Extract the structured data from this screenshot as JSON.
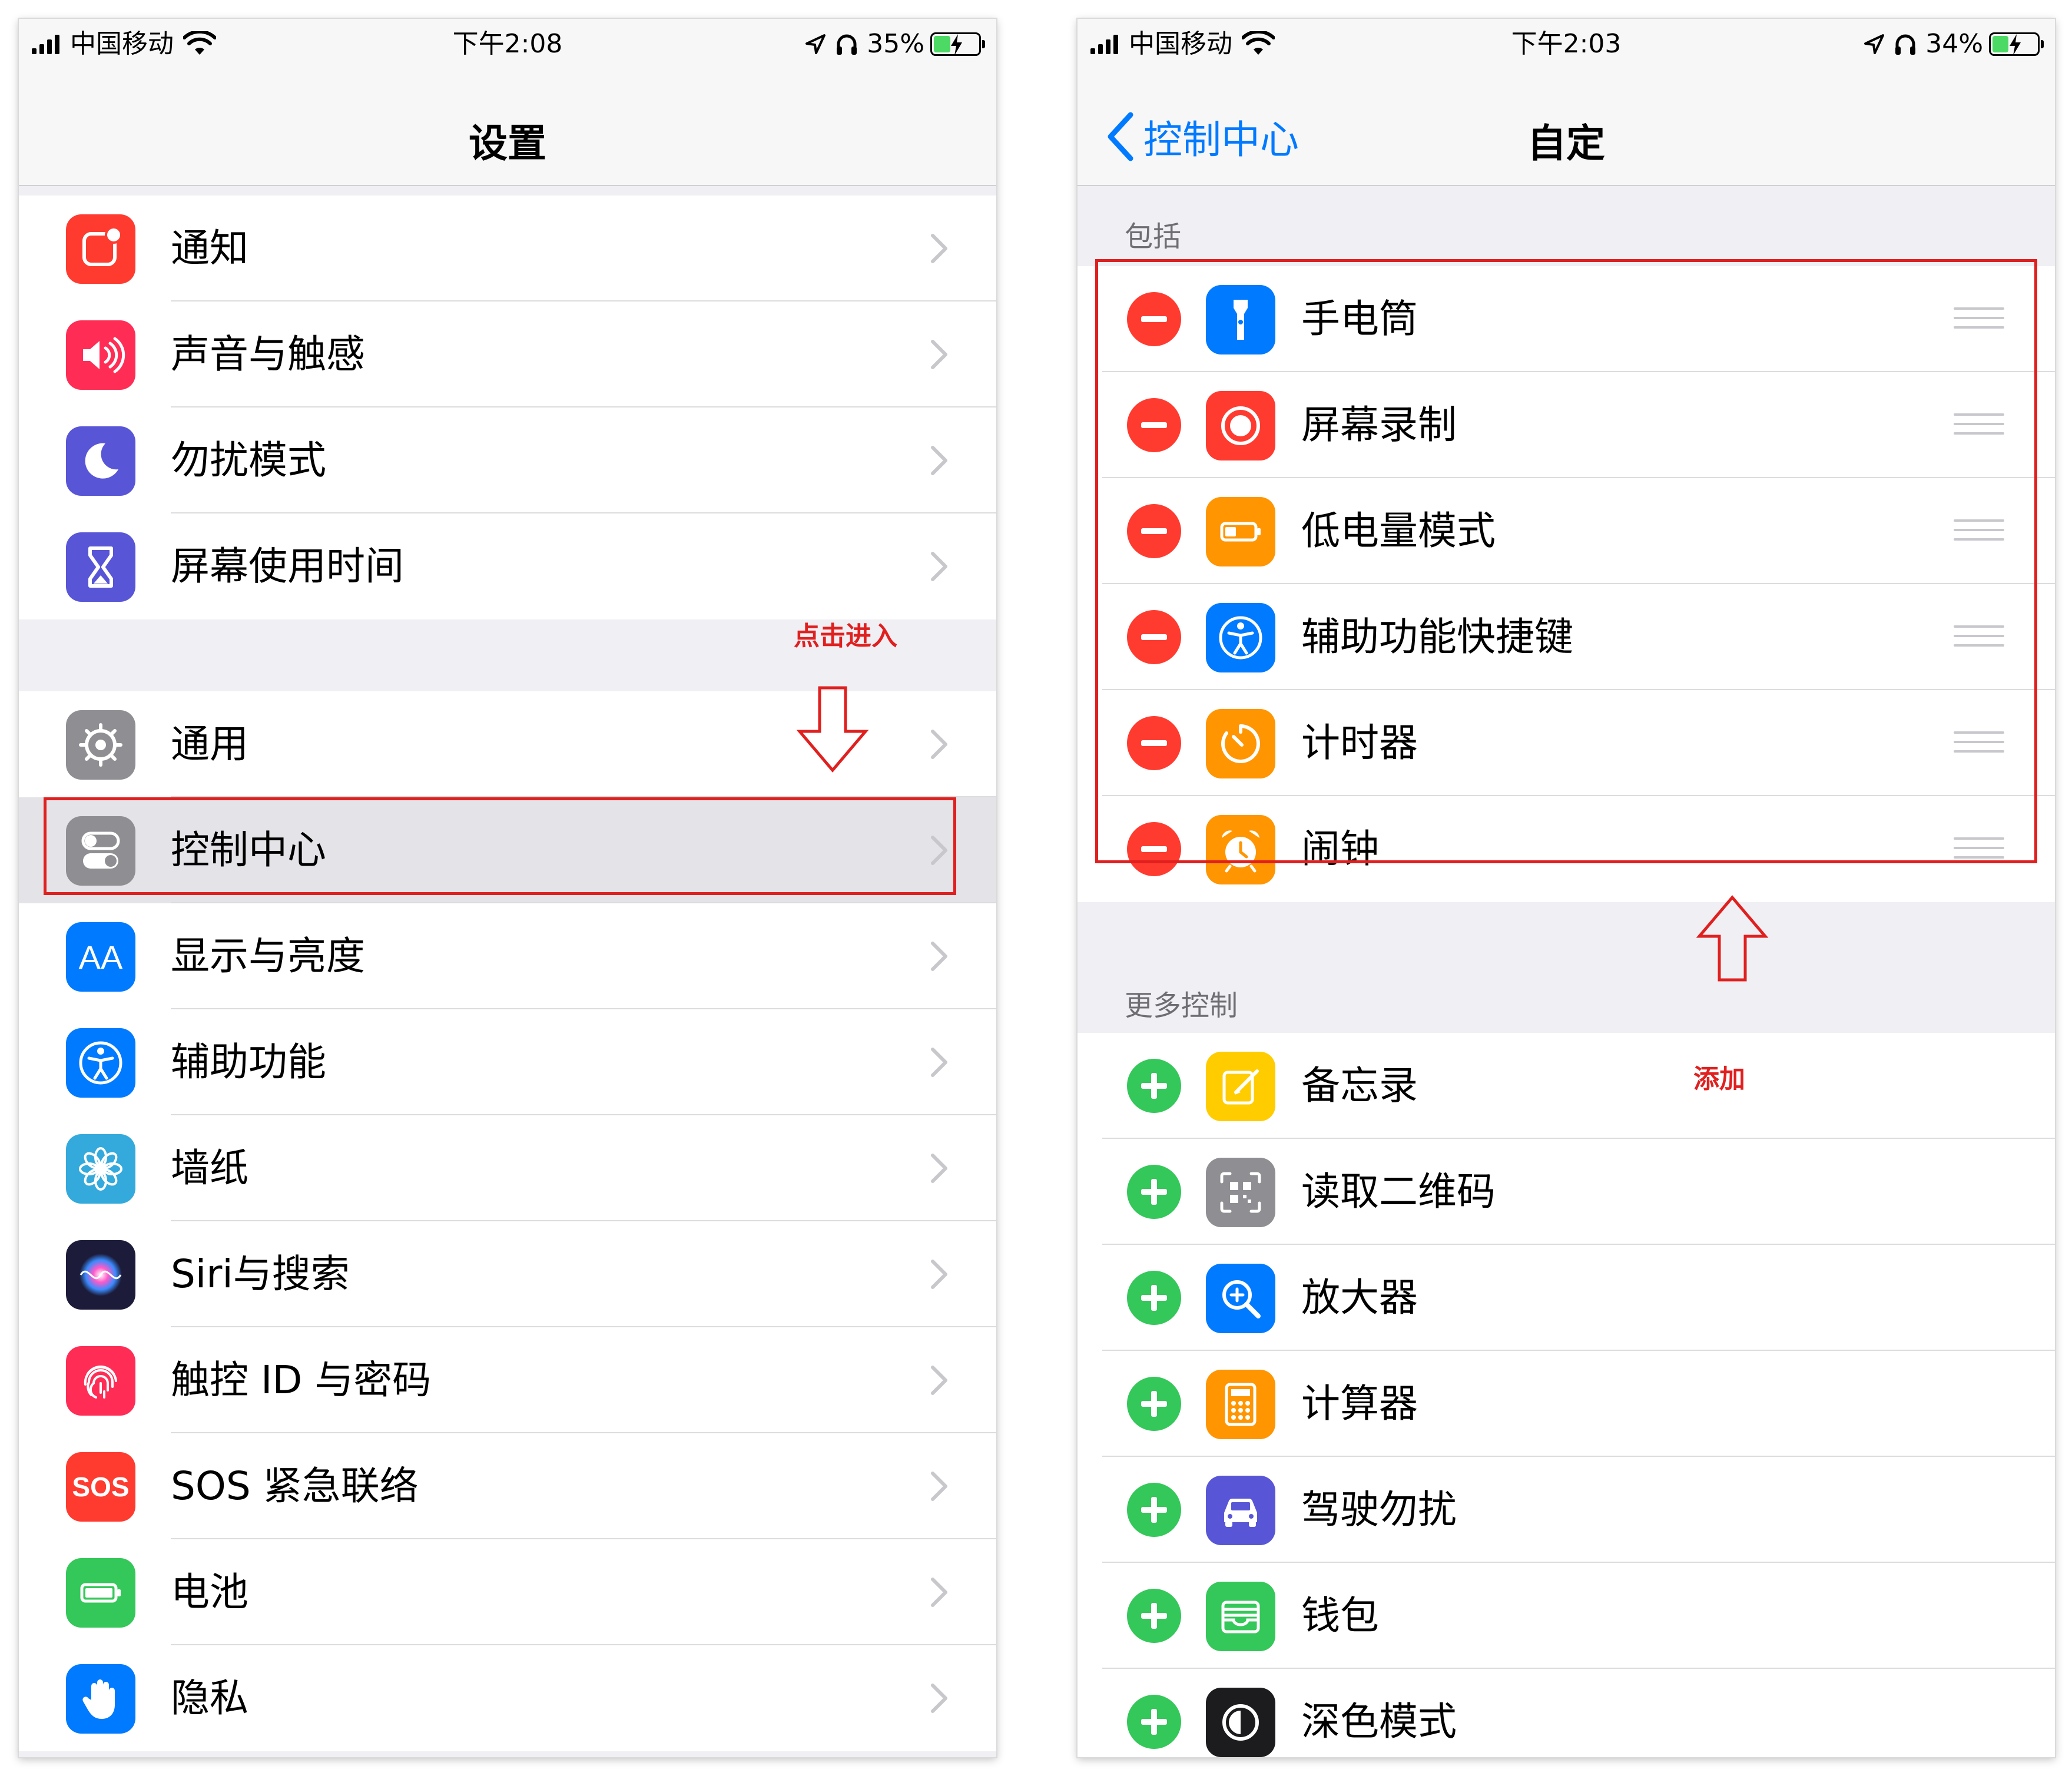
{
  "left_screen": {
    "status": {
      "carrier": "中国移动",
      "time": "下午2:08",
      "battery": "35%",
      "battery_level": 0.35
    },
    "title": "设置",
    "group1": [
      {
        "label": "通知",
        "icon": "notifications-icon",
        "color": "#ff3b30"
      },
      {
        "label": "声音与触感",
        "icon": "speaker-icon",
        "color": "#ff2d55"
      },
      {
        "label": "勿扰模式",
        "icon": "moon-icon",
        "color": "#5856d6"
      },
      {
        "label": "屏幕使用时间",
        "icon": "hourglass-icon",
        "color": "#5856d6"
      }
    ],
    "annotation_tap": "点击进入",
    "group2": [
      {
        "label": "通用",
        "icon": "gear-icon",
        "color": "#8e8e93"
      },
      {
        "label": "控制中心",
        "icon": "toggles-icon",
        "color": "#8e8e93"
      },
      {
        "label": "显示与亮度",
        "icon": "text-size-icon",
        "color": "#007aff"
      },
      {
        "label": "辅助功能",
        "icon": "accessibility-icon",
        "color": "#007aff"
      },
      {
        "label": "墙纸",
        "icon": "flower-icon",
        "color": "#34aadc"
      },
      {
        "label": "Siri与搜索",
        "icon": "siri-icon",
        "color": "#1c1c3a"
      },
      {
        "label": "触控 ID 与密码",
        "icon": "fingerprint-icon",
        "color": "#ff2d55"
      },
      {
        "label": "SOS 紧急联络",
        "icon": "sos-icon",
        "color": "#ff3b30"
      },
      {
        "label": "电池",
        "icon": "battery-icon",
        "color": "#34c759"
      },
      {
        "label": "隐私",
        "icon": "hand-icon",
        "color": "#007aff"
      }
    ],
    "sos_icon_text": "SOS",
    "aa_icon_text": "AA"
  },
  "right_screen": {
    "status": {
      "carrier": "中国移动",
      "time": "下午2:03",
      "battery": "34%",
      "battery_level": 0.34
    },
    "back_label": "控制中心",
    "title": "自定",
    "included_header": "包括",
    "included": [
      {
        "label": "手电筒",
        "icon": "flashlight-icon",
        "color": "#007aff"
      },
      {
        "label": "屏幕录制",
        "icon": "record-icon",
        "color": "#ff3b30"
      },
      {
        "label": "低电量模式",
        "icon": "low-battery-icon",
        "color": "#ff9500"
      },
      {
        "label": "辅助功能快捷键",
        "icon": "accessibility-icon",
        "color": "#007aff"
      },
      {
        "label": "计时器",
        "icon": "timer-icon",
        "color": "#ff9500"
      },
      {
        "label": "闹钟",
        "icon": "alarm-icon",
        "color": "#ff9500"
      }
    ],
    "more_header": "更多控制",
    "annotation_add": "添加",
    "more": [
      {
        "label": "备忘录",
        "icon": "notes-icon",
        "color": "#ffcc00"
      },
      {
        "label": "读取二维码",
        "icon": "qr-code-icon",
        "color": "#8e8e93"
      },
      {
        "label": "放大器",
        "icon": "magnifier-icon",
        "color": "#007aff"
      },
      {
        "label": "计算器",
        "icon": "calculator-icon",
        "color": "#ff9500"
      },
      {
        "label": "驾驶勿扰",
        "icon": "car-icon",
        "color": "#5856d6"
      },
      {
        "label": "钱包",
        "icon": "wallet-icon",
        "color": "#34c759"
      },
      {
        "label": "深色模式",
        "icon": "dark-mode-icon",
        "color": "#1c1c1e"
      }
    ]
  }
}
